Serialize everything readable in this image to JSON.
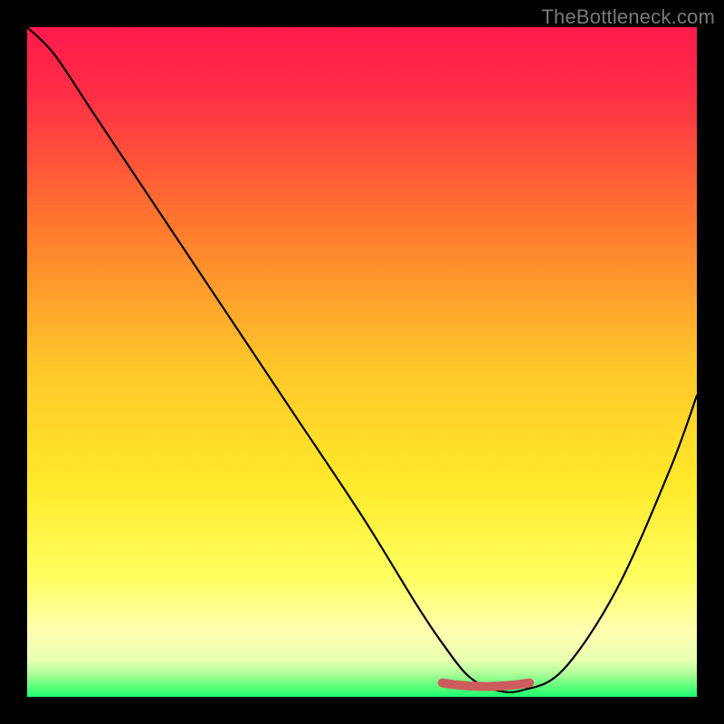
{
  "watermark": "TheBottleneck.com",
  "colors": {
    "gradient_top": "#ff1a4b",
    "gradient_mid1": "#ff8a2a",
    "gradient_mid2": "#ffe52a",
    "gradient_mid3": "#ffff8a",
    "gradient_bottom": "#1cff70",
    "curve": "#000000",
    "marker": "#cd5c5c",
    "frame": "#000000"
  },
  "chart_data": {
    "type": "line",
    "title": "",
    "xlabel": "",
    "ylabel": "",
    "xlim": [
      0,
      100
    ],
    "ylim": [
      0,
      100
    ],
    "series": [
      {
        "name": "bottleneck-curve",
        "x": [
          0,
          4,
          10,
          20,
          30,
          40,
          50,
          58,
          62,
          66,
          70,
          74,
          80,
          88,
          96,
          100
        ],
        "y": [
          100,
          96,
          87,
          72,
          57,
          42,
          27,
          14,
          8,
          3,
          1,
          1,
          4,
          16,
          34,
          45
        ]
      }
    ],
    "annotations": [
      {
        "name": "sweet-spot-marker",
        "x_start": 62,
        "x_end": 75,
        "y": 1
      }
    ],
    "grid": false,
    "legend": false
  }
}
